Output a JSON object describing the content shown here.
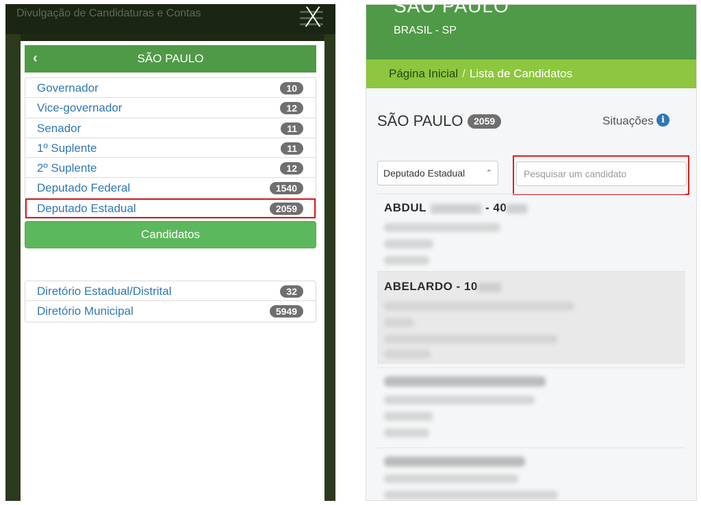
{
  "left_panel": {
    "topbar_title": "Divulgação de Candidaturas e Contas",
    "close_glyph": "X",
    "modal_title": "SÃO PAULO",
    "back_glyph": "‹",
    "offices": [
      {
        "label": "Governador",
        "count": "10"
      },
      {
        "label": "Vice-governador",
        "count": "12"
      },
      {
        "label": "Senador",
        "count": "11"
      },
      {
        "label": "1º Suplente",
        "count": "11"
      },
      {
        "label": "2º Suplente",
        "count": "12"
      },
      {
        "label": "Deputado Federal",
        "count": "1540"
      },
      {
        "label": "Deputado Estadual",
        "count": "2059"
      }
    ],
    "candidatos_button": "Candidatos",
    "directories": [
      {
        "label": "Diretório Estadual/Distrital",
        "count": "32"
      },
      {
        "label": "Diretório Municipal",
        "count": "5949"
      }
    ]
  },
  "right_panel": {
    "city": "SÃO PAULO",
    "subtitle": "BRASIL - SP",
    "breadcrumb": {
      "home": "Página Inicial",
      "separator": "/",
      "current": "Lista de Candidatos"
    },
    "title": "SÃO PAULO -",
    "count": "2059",
    "situacoes_label": "Situações",
    "info_icon": "i",
    "select_value": "Deputado Estadual",
    "search_placeholder": "Pesquisar um candidato",
    "candidates": [
      {
        "name": "ABDUL",
        "suffix": "- 40"
      },
      {
        "name": "ABELARDO - 10",
        "suffix": ""
      }
    ]
  },
  "colors": {
    "header_green": "#4f9a47",
    "breadcrumb_green": "#8dc63f",
    "button_green": "#5cb85c",
    "link_blue": "#2f77b5",
    "highlight_red": "#e01b1b",
    "badge_gray": "#6f6f6f"
  }
}
